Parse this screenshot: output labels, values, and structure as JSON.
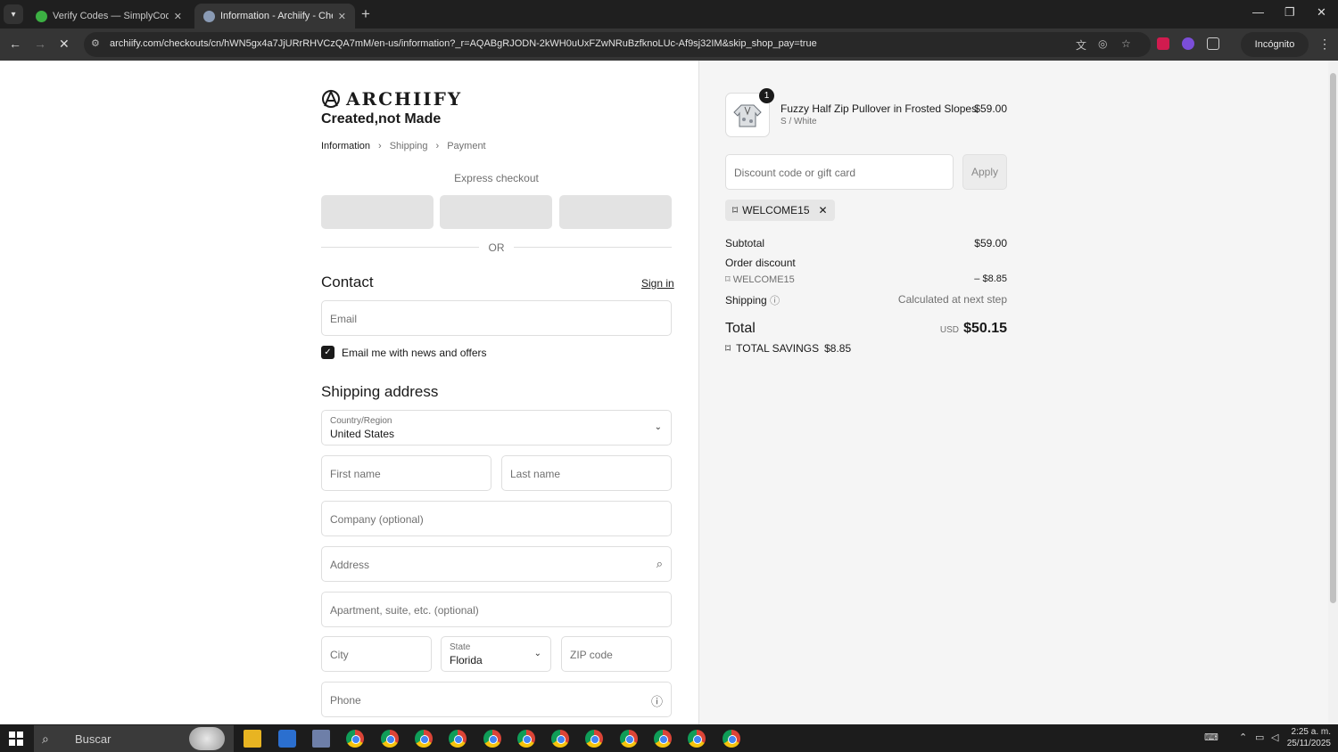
{
  "browser": {
    "tabs": [
      {
        "title": "Verify Codes — SimplyCodes",
        "active": false
      },
      {
        "title": "Information - Archiify - Checko",
        "active": true
      }
    ],
    "url": "archiify.com/checkouts/cn/hWN5gx4a7JjURrRHVCzQA7mM/en-us/information?_r=AQABgRJODN-2kWH0uUxFZwNRuBzfknoLUc-Af9sj32IM&skip_shop_pay=true",
    "incognito_label": "Incógnito"
  },
  "header": {
    "logo_text": "ARCHIIFY",
    "tagline": "Created,not Made"
  },
  "breadcrumb": {
    "items": [
      "Information",
      "Shipping",
      "Payment"
    ]
  },
  "express": {
    "label": "Express checkout",
    "or": "OR"
  },
  "contact": {
    "heading": "Contact",
    "sign_in": "Sign in",
    "email_placeholder": "Email",
    "newsletter_label": "Email me with news and offers",
    "newsletter_checked": true
  },
  "shipping": {
    "heading": "Shipping address",
    "country_label": "Country/Region",
    "country_value": "United States",
    "first_name_placeholder": "First name",
    "last_name_placeholder": "Last name",
    "company_placeholder": "Company (optional)",
    "address_placeholder": "Address",
    "apartment_placeholder": "Apartment, suite, etc. (optional)",
    "city_placeholder": "City",
    "state_label": "State",
    "state_value": "Florida",
    "zip_placeholder": "ZIP code",
    "phone_placeholder": "Phone"
  },
  "order": {
    "product": {
      "name": "Fuzzy Half Zip Pullover in Frosted Slopes",
      "variant": "S / White",
      "price": "$59.00",
      "quantity": "1"
    },
    "discount_placeholder": "Discount code or gift card",
    "apply_label": "Apply",
    "applied_code": "WELCOME15",
    "subtotal_label": "Subtotal",
    "subtotal_value": "$59.00",
    "order_discount_label": "Order discount",
    "discount_code": "WELCOME15",
    "discount_value": "– $8.85",
    "shipping_label": "Shipping",
    "shipping_value": "Calculated at next step",
    "total_label": "Total",
    "currency": "USD",
    "total_value": "$50.15",
    "savings_label": "TOTAL SAVINGS",
    "savings_value": "$8.85"
  },
  "taskbar": {
    "search_label": "Buscar",
    "time": "2:25 a. m.",
    "date": "25/11/2025"
  },
  "colors": {
    "accent": "#1a1a1a",
    "summary_bg": "#f5f5f5",
    "chrome_dark": "#1f1f1f"
  }
}
